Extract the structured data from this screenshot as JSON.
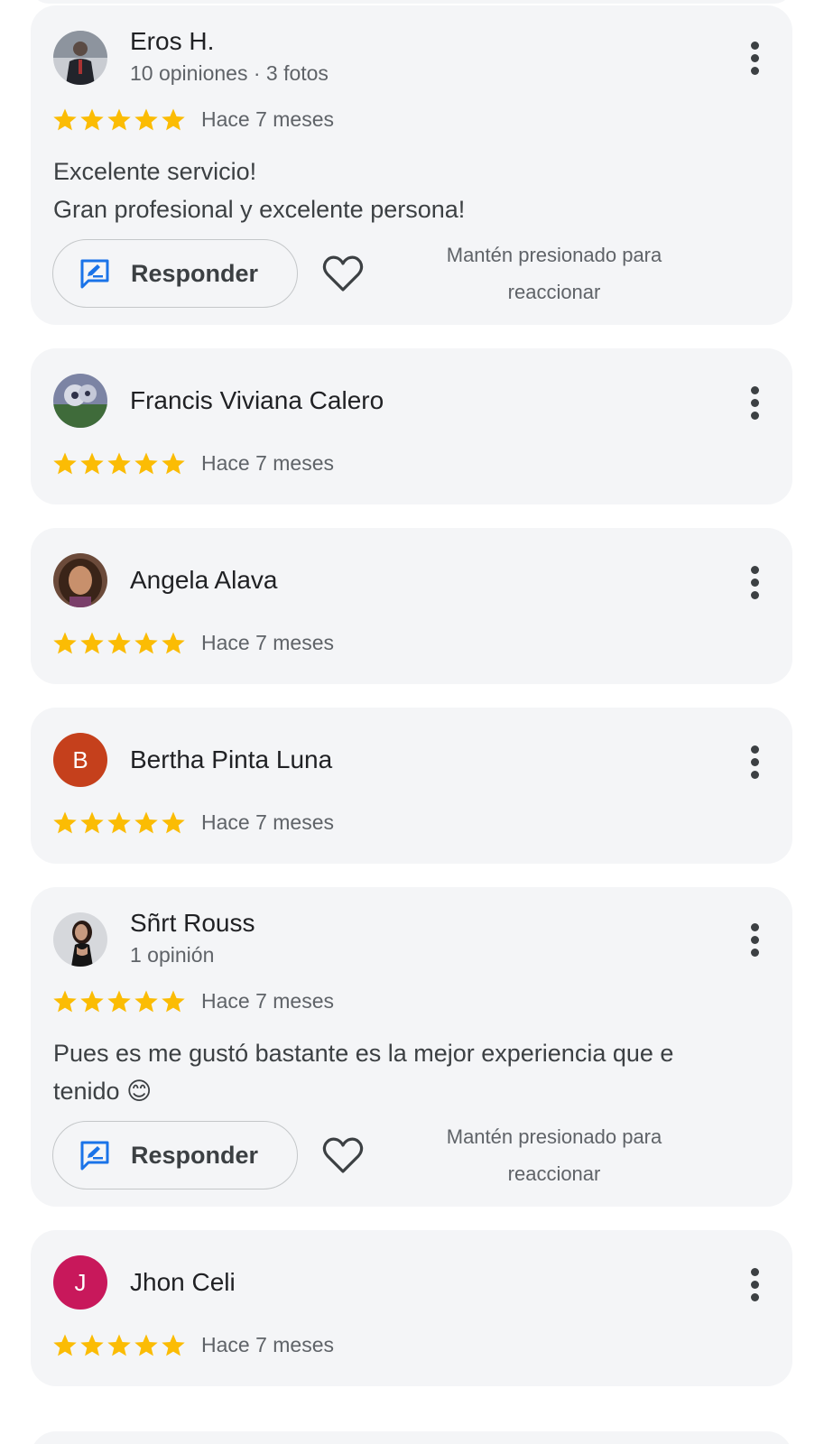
{
  "colors": {
    "card_background": "#f4f5f7",
    "star": "#fbbc04",
    "reply_icon": "#1a73e8",
    "avatar_bertha": "#c5401c",
    "avatar_jhon": "#c8185b"
  },
  "reviews": [
    {
      "name": "Eros H.",
      "meta": "10 opiniones · 3 fotos",
      "rating": 5,
      "date": "Hace 7 meses",
      "text_lines": [
        "Excelente servicio!",
        "Gran profesional y excelente persona!"
      ],
      "reply_label": "Responder",
      "hint_line1": "Mantén presionado para",
      "hint_line2": "reaccionar",
      "avatar": "photo-icon"
    },
    {
      "name": "Francis Viviana Calero",
      "rating": 5,
      "date": "Hace 7 meses",
      "avatar": "photo-icon"
    },
    {
      "name": "Angela Alava",
      "rating": 5,
      "date": "Hace 7 meses",
      "avatar": "photo-icon"
    },
    {
      "name": "Bertha Pinta Luna",
      "rating": 5,
      "date": "Hace 7 meses",
      "avatar_letter": "B"
    },
    {
      "name": "Sñrt Rouss",
      "meta": "1 opinión",
      "rating": 5,
      "date": "Hace 7 meses",
      "text_lines": [
        "Pues es me gustó bastante es la mejor experiencia que e",
        "tenido 😊"
      ],
      "reply_label": "Responder",
      "hint_line1": "Mantén presionado para",
      "hint_line2": "reaccionar",
      "avatar": "photo-icon"
    },
    {
      "name": "Jhon Celi",
      "rating": 5,
      "date": "Hace 7 meses",
      "avatar_letter": "J"
    }
  ]
}
